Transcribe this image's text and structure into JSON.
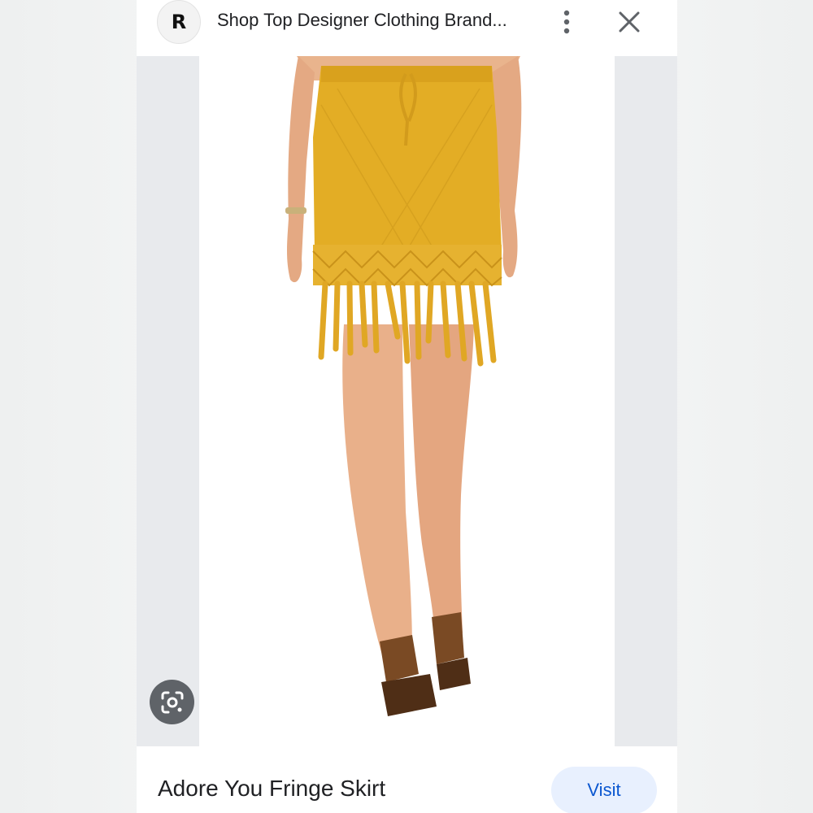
{
  "header": {
    "favicon_letter": "R",
    "source_title": "Shop Top Designer Clothing Brand..."
  },
  "image": {
    "subject": "model wearing mustard crochet fringe skirt with brown platform sandals",
    "skirt_color": "#e3ad25",
    "skin_color": "#e8b08a",
    "sandal_color": "#7a4a24"
  },
  "product": {
    "title": "Adore You Fringe Skirt",
    "visit_label": "Visit"
  },
  "colors": {
    "accent": "#0b57d0",
    "visit_bg": "#e8f0fe",
    "lens_bg": "#5f6368"
  },
  "icons": {
    "more": "more-vert-icon",
    "close": "close-icon",
    "lens": "lens-icon"
  }
}
